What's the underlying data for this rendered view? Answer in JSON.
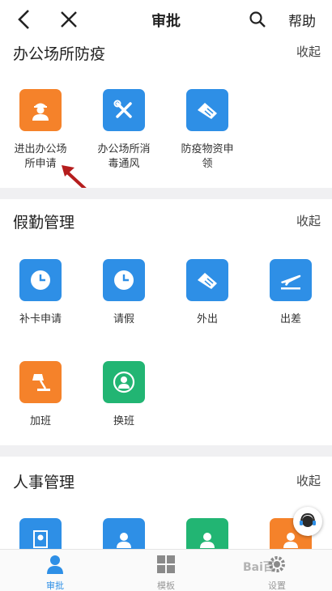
{
  "header": {
    "title": "审批",
    "help_label": "帮助"
  },
  "sections": [
    {
      "title": "办公场所防疫",
      "collapse_label": "收起",
      "items": [
        {
          "label": "进出办公场\n所申请",
          "color": "#f5822a",
          "icon": "worker-icon"
        },
        {
          "label": "办公场所消\n毒通风",
          "color": "#2e8fe6",
          "icon": "tools-icon"
        },
        {
          "label": "防疫物资申\n领",
          "color": "#2e8fe6",
          "icon": "handshake-icon"
        }
      ]
    },
    {
      "title": "假勤管理",
      "collapse_label": "收起",
      "items": [
        {
          "label": "补卡申请",
          "color": "#2e8fe6",
          "icon": "clock-icon"
        },
        {
          "label": "请假",
          "color": "#2e8fe6",
          "icon": "clock-icon"
        },
        {
          "label": "外出",
          "color": "#2e8fe6",
          "icon": "handshake-icon"
        },
        {
          "label": "出差",
          "color": "#2e8fe6",
          "icon": "airplane-icon"
        },
        {
          "label": "加班",
          "color": "#f5822a",
          "icon": "desk-lamp-icon"
        },
        {
          "label": "换班",
          "color": "#22b573",
          "icon": "swap-user-icon"
        }
      ]
    },
    {
      "title": "人事管理",
      "collapse_label": "收起"
    }
  ],
  "tabs": [
    {
      "label": "审批",
      "active": true,
      "icon": "approval-user-icon"
    },
    {
      "label": "模板",
      "active": false,
      "icon": "grid-icon"
    },
    {
      "label": "设置",
      "active": false,
      "icon": "gear-icon"
    }
  ],
  "watermark": "Bai百"
}
